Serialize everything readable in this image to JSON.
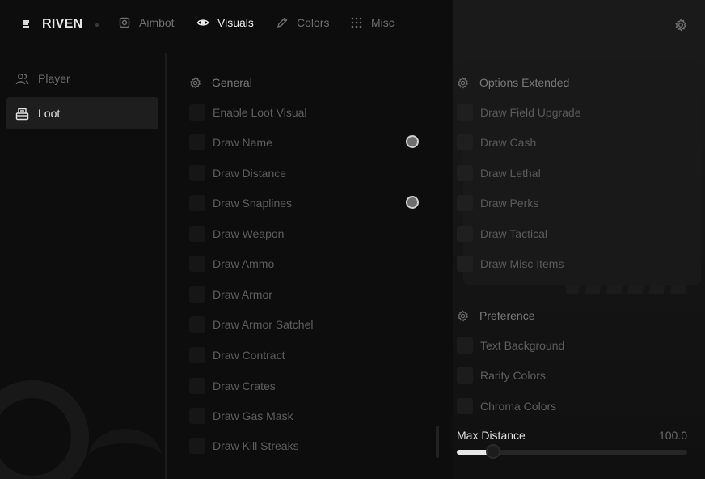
{
  "brand": {
    "name": "RIVEN",
    "icon": "riven-logo-icon"
  },
  "nav": {
    "tabs": [
      {
        "label": "Aimbot",
        "icon": "crosshair-icon",
        "active": false
      },
      {
        "label": "Visuals",
        "icon": "eye-icon",
        "active": true
      },
      {
        "label": "Colors",
        "icon": "pen-icon",
        "active": false
      },
      {
        "label": "Misc",
        "icon": "grid-dots-icon",
        "active": false
      }
    ],
    "settings_icon": "gear-icon"
  },
  "sidebar": {
    "items": [
      {
        "label": "Player",
        "icon": "users-icon",
        "active": false
      },
      {
        "label": "Loot",
        "icon": "box-icon",
        "active": true
      }
    ]
  },
  "general": {
    "title": "General",
    "items": [
      {
        "label": "Enable Loot Visual"
      },
      {
        "label": "Draw Name",
        "has_color": true
      },
      {
        "label": "Draw Distance"
      },
      {
        "label": "Draw Snaplines",
        "has_color": true
      },
      {
        "label": "Draw Weapon"
      },
      {
        "label": "Draw Ammo"
      },
      {
        "label": "Draw Armor"
      },
      {
        "label": "Draw Armor Satchel"
      },
      {
        "label": "Draw Contract"
      },
      {
        "label": "Draw Crates"
      },
      {
        "label": "Draw Gas Mask"
      },
      {
        "label": "Draw Kill Streaks"
      }
    ]
  },
  "options_extended": {
    "title": "Options Extended",
    "items": [
      {
        "label": "Draw Field Upgrade"
      },
      {
        "label": "Draw Cash"
      },
      {
        "label": "Draw Lethal"
      },
      {
        "label": "Draw Perks"
      },
      {
        "label": "Draw Tactical"
      },
      {
        "label": "Draw Misc Items"
      }
    ]
  },
  "preference": {
    "title": "Preference",
    "items": [
      {
        "label": "Text Background"
      },
      {
        "label": "Rarity Colors"
      },
      {
        "label": "Chroma Colors"
      }
    ]
  },
  "max_distance": {
    "label": "Max Distance",
    "value_text": "100.0",
    "fill_fraction": 0.13
  },
  "colors": {
    "background": "#0d0d0e",
    "card": "#191919",
    "active_text": "#e8e8e8",
    "muted_text": "#5e5e5e"
  }
}
